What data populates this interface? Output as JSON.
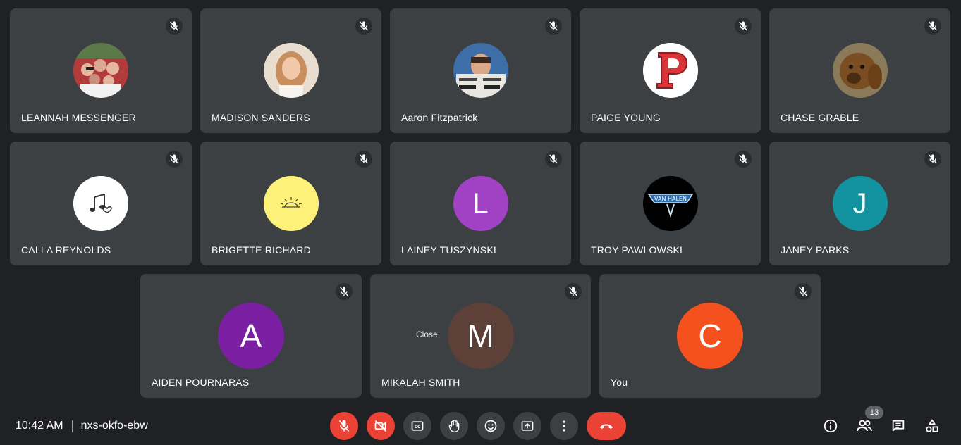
{
  "tiles_row1": [
    {
      "name": "LEANNAH MESSENGER",
      "avatar_type": "photo-group"
    },
    {
      "name": "MADISON SANDERS",
      "avatar_type": "photo-portrait"
    },
    {
      "name": "Aaron Fitzpatrick",
      "avatar_type": "photo-newspaper"
    },
    {
      "name": "PAIGE YOUNG",
      "avatar_type": "logo-p"
    },
    {
      "name": "CHASE GRABLE",
      "avatar_type": "photo-dog"
    }
  ],
  "tiles_row2": [
    {
      "name": "CALLA REYNOLDS",
      "avatar_type": "music-notes"
    },
    {
      "name": "BRIGETTE RICHARD",
      "avatar_type": "sun-sketch"
    },
    {
      "name": "LAINEY TUSZYNSKI",
      "initial": "L",
      "color": "#a142c5"
    },
    {
      "name": "TROY PAWLOWSKI",
      "avatar_type": "band-logo"
    },
    {
      "name": "JANEY PARKS",
      "initial": "J",
      "color": "#12939f"
    }
  ],
  "tiles_row3": [
    {
      "name": "AIDEN POURNARAS",
      "initial": "A",
      "color": "#7b1fa2"
    },
    {
      "name": "MIKALAH SMITH",
      "initial": "M",
      "color": "#5d4037",
      "hover_label": "Close"
    },
    {
      "name": "You",
      "initial": "C",
      "color": "#f4511e"
    }
  ],
  "meeting": {
    "time": "10:42 AM",
    "code": "nxs-okfo-ebw"
  },
  "controls": [
    {
      "name": "mic-off-icon",
      "state": "off"
    },
    {
      "name": "camera-off-icon",
      "state": "off"
    },
    {
      "name": "captions-icon"
    },
    {
      "name": "raise-hand-icon"
    },
    {
      "name": "emoji-icon"
    },
    {
      "name": "present-icon"
    },
    {
      "name": "more-options-icon"
    },
    {
      "name": "end-call-icon"
    }
  ],
  "right_controls": {
    "participants_count": "13"
  },
  "colors": {
    "background": "#202124",
    "tile": "#3c4043",
    "red": "#ea4335"
  }
}
